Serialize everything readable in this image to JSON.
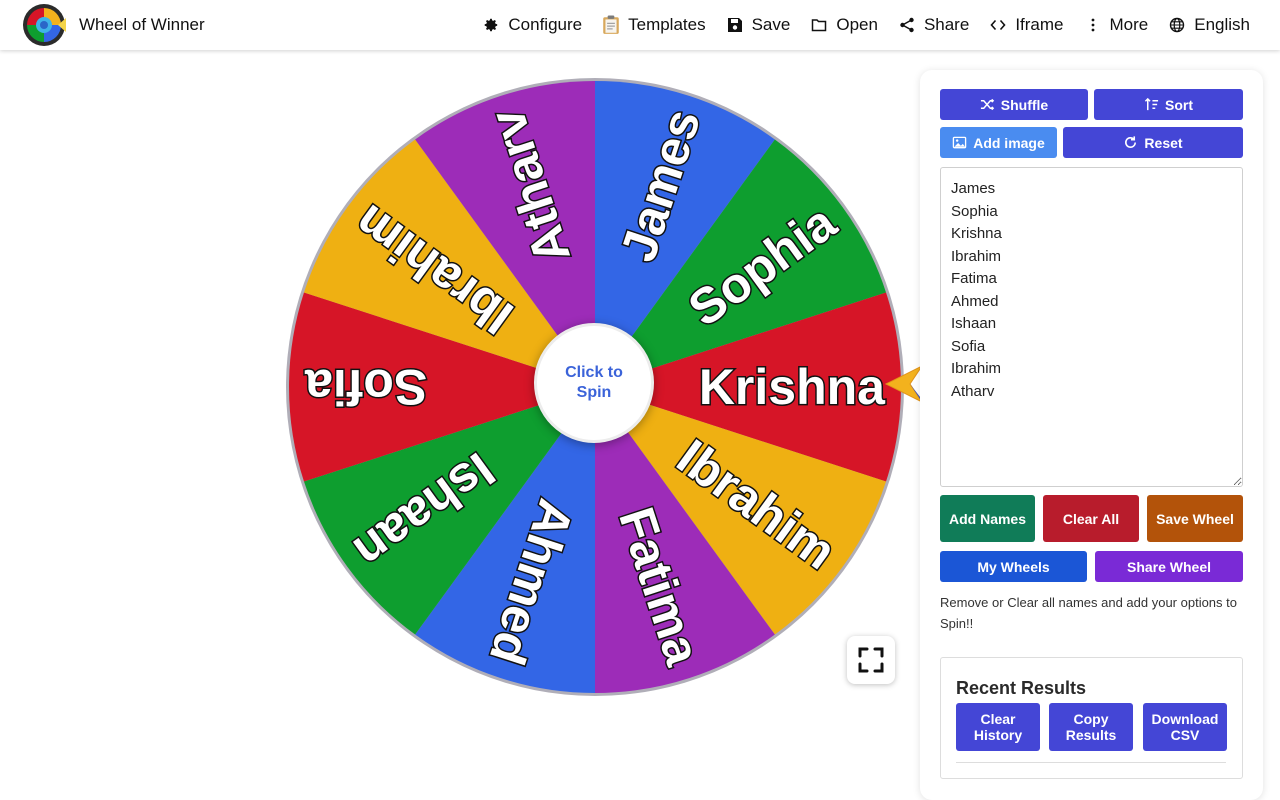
{
  "app": {
    "title": "Wheel of Winner"
  },
  "nav": {
    "items": [
      {
        "label": "Configure",
        "icon": "gear-icon"
      },
      {
        "label": "Templates",
        "icon": "clipboard-icon"
      },
      {
        "label": "Save",
        "icon": "floppy-icon"
      },
      {
        "label": "Open",
        "icon": "folder-icon"
      },
      {
        "label": "Share",
        "icon": "share-icon"
      },
      {
        "label": "Iframe",
        "icon": "code-icon"
      },
      {
        "label": "More",
        "icon": "more-vertical-icon"
      },
      {
        "label": "English",
        "icon": "globe-icon"
      }
    ]
  },
  "wheel": {
    "spin_label_line1": "Click to",
    "spin_label_line2": "Spin",
    "segments": [
      {
        "name": "James",
        "color": "#3366e6"
      },
      {
        "name": "Sophia",
        "color": "#0e9e2f"
      },
      {
        "name": "Krishna",
        "color": "#d61527"
      },
      {
        "name": "Ibrahim",
        "color": "#efb012"
      },
      {
        "name": "Fatima",
        "color": "#9d2cb8"
      },
      {
        "name": "Ahmed",
        "color": "#3366e6"
      },
      {
        "name": "Ishaan",
        "color": "#0e9e2f"
      },
      {
        "name": "Sofia",
        "color": "#d61527"
      },
      {
        "name": "Ibrahim",
        "color": "#efb012"
      },
      {
        "name": "Atharv",
        "color": "#9d2cb8"
      }
    ],
    "rim_color": "#b0aeb8",
    "pointer_color": "#f3b21d"
  },
  "panel": {
    "shuffle_label": "Shuffle",
    "sort_label": "Sort",
    "add_image_label": "Add image",
    "reset_label": "Reset",
    "names_text": "James\nSophia\nKrishna\nIbrahim\nFatima\nAhmed\nIshaan\nSofia\nIbrahim\nAtharv",
    "add_names_label": "Add Names",
    "clear_all_label": "Clear All",
    "save_wheel_label": "Save Wheel",
    "my_wheels_label": "My Wheels",
    "share_wheel_label": "Share Wheel",
    "hint": "Remove or Clear all names and add your options to Spin!!",
    "recent_title": "Recent Results",
    "clear_history_label": "Clear History",
    "copy_results_label": "Copy Results",
    "download_csv_label": "Download CSV"
  },
  "colors": {
    "indigo": "#4446d6",
    "light_blue": "#4a8cf0",
    "green": "#107c58",
    "red": "#b81c2c",
    "orange": "#b3530a",
    "blue": "#1b56d6",
    "purple": "#7a2ad6"
  }
}
